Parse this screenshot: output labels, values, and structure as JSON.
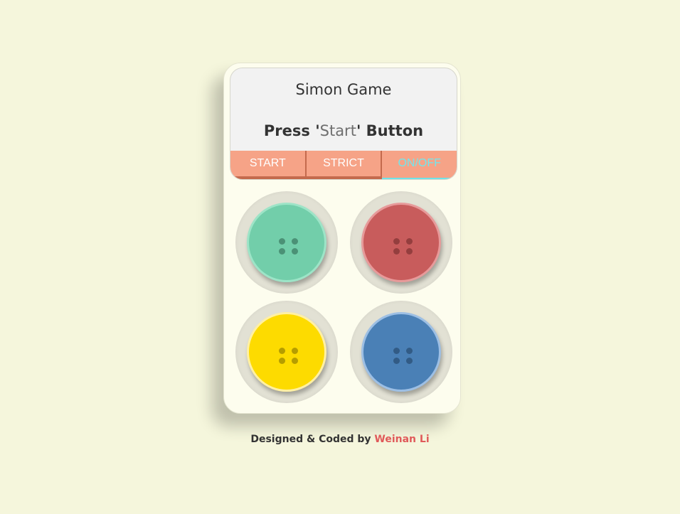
{
  "game": {
    "title": "Simon Game",
    "status_prefix": "Press '",
    "status_highlight": "Start",
    "status_suffix": "' Button",
    "controls": {
      "start_label": "START",
      "strict_label": "STRICT",
      "onoff_label": "ON/OFF"
    }
  },
  "pads": [
    {
      "color": "#72ceaa",
      "border": "#9de4c7",
      "hole_color": "#2b5e4b",
      "icon": "button-icon"
    },
    {
      "color": "#c85c5c",
      "border": "#e79a9a",
      "hole_color": "#6a2626",
      "icon": "button-icon"
    },
    {
      "color": "#fddb00",
      "border": "#fff0a3",
      "hole_color": "#7a6a00",
      "icon": "button-icon"
    },
    {
      "color": "#4a80b6",
      "border": "#9dbfe4",
      "hole_color": "#1f3d5c",
      "icon": "button-icon"
    }
  ],
  "footer": {
    "credit_prefix": "Designed & Coded by ",
    "author": "Weinan Li"
  }
}
